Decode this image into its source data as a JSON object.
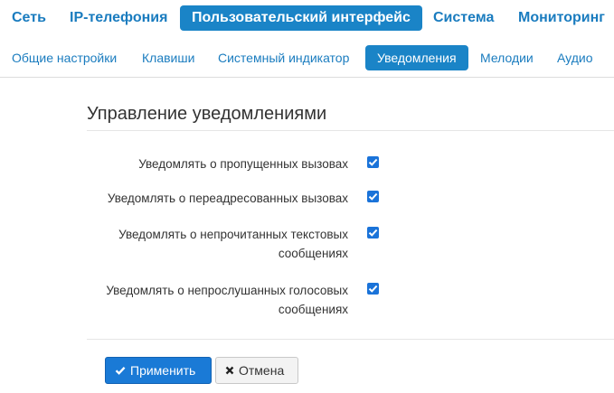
{
  "top_nav": {
    "items": [
      {
        "label": "Сеть"
      },
      {
        "label": "IP-телефония"
      },
      {
        "label": "Пользовательский интерфейс",
        "active": true
      },
      {
        "label": "Система"
      },
      {
        "label": "Мониторинг"
      }
    ]
  },
  "sub_nav": {
    "items": [
      {
        "label": "Общие настройки"
      },
      {
        "label": "Клавиши"
      },
      {
        "label": "Системный индикатор"
      },
      {
        "label": "Уведомления",
        "active": true
      },
      {
        "label": "Мелодии"
      },
      {
        "label": "Аудио"
      }
    ]
  },
  "main": {
    "title": "Управление уведомлениями",
    "options": [
      {
        "label": "Уведомлять о пропущенных вызовах",
        "checked": true
      },
      {
        "label": "Уведомлять о переадресованных вызовах",
        "checked": true
      },
      {
        "label_line1": "Уведомлять о непрочитанных текстовых",
        "label_line2": "сообщениях",
        "checked": true
      },
      {
        "label_line1": "Уведомлять о непрослушанных голосовых",
        "label_line2": "сообщениях",
        "checked": true
      }
    ]
  },
  "buttons": {
    "apply_label": "Применить",
    "cancel_label": "Отмена"
  },
  "colors": {
    "accent": "#1a84c7",
    "link": "#1a7cbf",
    "checkbox": "#1a73d9"
  },
  "icons": {
    "apply": "check-icon",
    "cancel": "x-icon"
  }
}
